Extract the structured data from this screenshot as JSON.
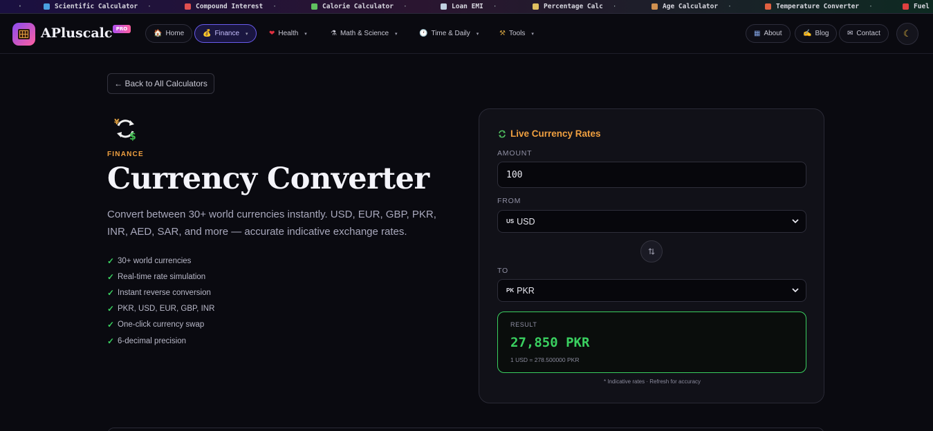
{
  "ticker": {
    "items": [
      {
        "icon": "flask-icon",
        "label": "Scientific Calculator",
        "color": "#4aa0e0"
      },
      {
        "icon": "chart-up-icon",
        "label": "Compound Interest",
        "color": "#e05050"
      },
      {
        "icon": "salad-icon",
        "label": "Calorie Calculator",
        "color": "#60c060"
      },
      {
        "icon": "receipt-icon",
        "label": "Loan EMI",
        "color": "#c0d0e0"
      },
      {
        "icon": "bar-chart-icon",
        "label": "Percentage Calc",
        "color": "#e0c060"
      },
      {
        "icon": "cake-icon",
        "label": "Age Calculator",
        "color": "#d09050"
      },
      {
        "icon": "thermometer-icon",
        "label": "Temperature Converter",
        "color": "#e06040"
      },
      {
        "icon": "fuel-pump-icon",
        "label": "Fuel",
        "color": "#e04040"
      }
    ],
    "separator": "·"
  },
  "nav": {
    "logo_text": "APluscalc",
    "pro_badge": "PRO",
    "links": [
      {
        "icon": "home-icon",
        "emoji": "🏠",
        "label": "Home",
        "dropdown": false
      },
      {
        "icon": "money-bag-icon",
        "emoji": "💰",
        "label": "Finance",
        "dropdown": true,
        "active": true
      },
      {
        "icon": "heart-icon",
        "emoji": "❤",
        "label": "Health",
        "dropdown": true
      },
      {
        "icon": "microscope-icon",
        "emoji": "⚗",
        "label": "Math & Science",
        "dropdown": true
      },
      {
        "icon": "clock-icon",
        "emoji": "🕐",
        "label": "Time & Daily",
        "dropdown": true
      },
      {
        "icon": "tools-icon",
        "emoji": "⚒",
        "label": "Tools",
        "dropdown": true
      }
    ],
    "right_links": [
      {
        "icon": "building-icon",
        "emoji": "▦",
        "label": "About"
      },
      {
        "icon": "writing-hand-icon",
        "emoji": "✍",
        "label": "Blog"
      },
      {
        "icon": "envelope-icon",
        "emoji": "✉",
        "label": "Contact"
      }
    ],
    "theme_toggle_icon": "moon-icon"
  },
  "back_button": "← Back to All Calculators",
  "hero": {
    "icon": "currency-exchange-icon",
    "category": "FINANCE",
    "title": "Currency Converter",
    "description": "Convert between 30+ world currencies instantly. USD, EUR, GBP, PKR, INR, AED, SAR, and more — accurate indicative exchange rates.",
    "features": [
      "30+ world currencies",
      "Real-time rate simulation",
      "Instant reverse conversion",
      "PKR, USD, EUR, GBP, INR",
      "One-click currency swap",
      "6-decimal precision"
    ]
  },
  "converter": {
    "title": "Live Currency Rates",
    "title_icon": "refresh-icon",
    "amount_label": "AMOUNT",
    "amount_value": "100",
    "from_label": "FROM",
    "from_flag": "US",
    "from_value": "USD",
    "to_label": "TO",
    "to_flag": "PK",
    "to_value": "PKR",
    "swap_icon": "swap-vertical-icon",
    "result_label": "RESULT",
    "result_value": "27,850 PKR",
    "result_rate": "1 USD = 278.500000 PKR",
    "note": "* Indicative rates · Refresh for accuracy",
    "accent_color": "#3ad060",
    "highlight_color": "#f0a040"
  }
}
